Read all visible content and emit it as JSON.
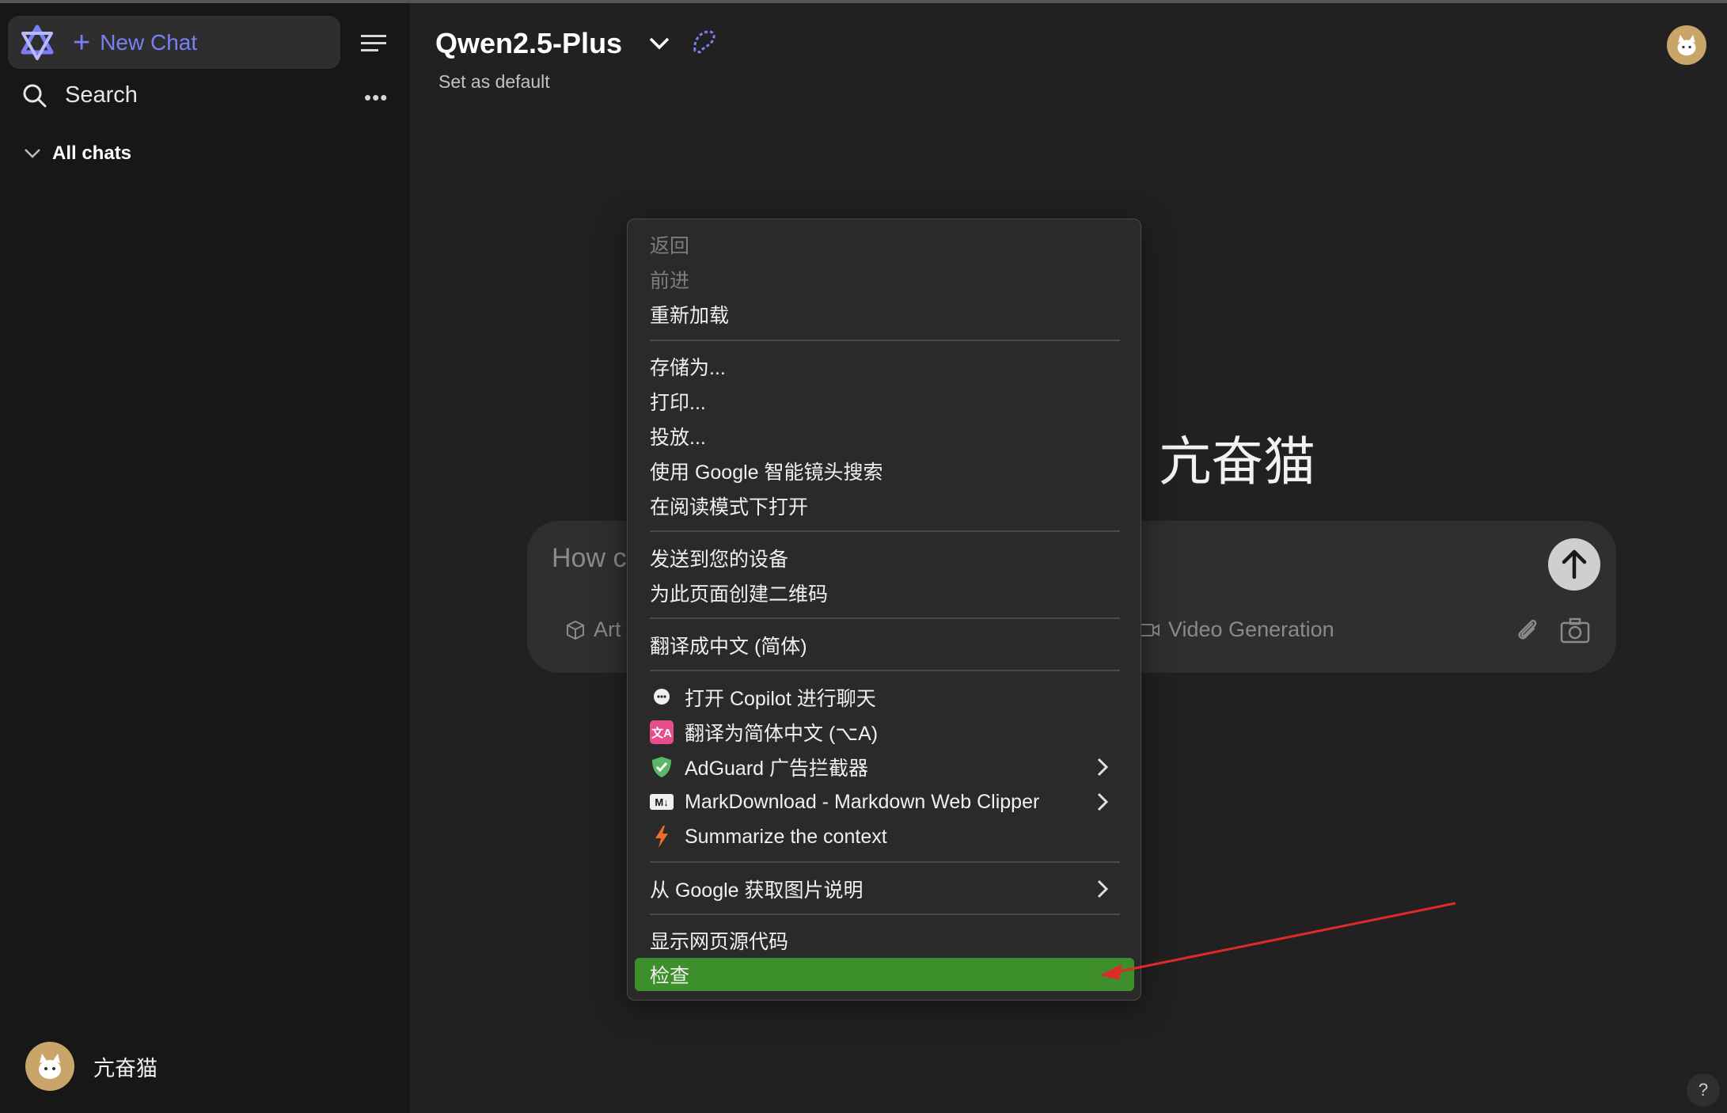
{
  "sidebar": {
    "new_chat_label": "New Chat",
    "search_label": "Search",
    "all_chats_label": "All chats",
    "user_name": "亢奋猫"
  },
  "header": {
    "model_name": "Qwen2.5-Plus",
    "set_default": "Set as default"
  },
  "main": {
    "greeting_visible": "g, 亢奋猫",
    "input_placeholder_visible": "How c",
    "chip_artifacts_visible": "Art",
    "chip_video": "Video Generation"
  },
  "context_menu": {
    "back": "返回",
    "forward": "前进",
    "reload": "重新加载",
    "save_as": "存储为...",
    "print": "打印...",
    "cast": "投放...",
    "google_lens": "使用 Google 智能镜头搜索",
    "reader_mode": "在阅读模式下打开",
    "send_to_devices": "发送到您的设备",
    "qr_code": "为此页面创建二维码",
    "translate": "翻译成中文 (简体)",
    "copilot": "打开 Copilot 进行聊天",
    "translate_ext": "翻译为简体中文 (⌥A)",
    "translate_ext_icon_text": "文A",
    "adguard": "AdGuard 广告拦截器",
    "markdownload": "MarkDownload - Markdown Web Clipper",
    "markdownload_icon_text": "M↓",
    "summarize": "Summarize the context",
    "image_desc": "从 Google 获取图片说明",
    "view_source": "显示网页源代码",
    "inspect": "检查"
  },
  "help_label": "?",
  "colors": {
    "accent": "#7b7ff6",
    "highlight": "#3c8f2b",
    "arrow": "#e02a2a"
  }
}
